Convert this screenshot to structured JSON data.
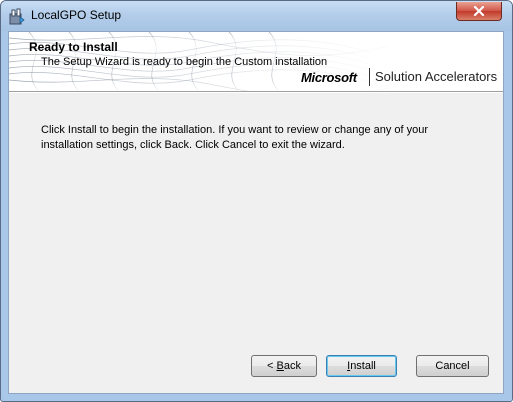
{
  "window": {
    "title": "LocalGPO Setup",
    "close_label": "Close"
  },
  "banner": {
    "title": "Ready to Install",
    "subtitle": "The Setup Wizard is ready to begin the Custom installation",
    "brand": "Microsoft",
    "product": "Solution Accelerators"
  },
  "body": {
    "message": "Click Install to begin the installation. If you want to review or change any of your installation settings, click Back. Click Cancel to exit the wizard."
  },
  "buttons": {
    "back_prefix": "< ",
    "back_mnemonic": "B",
    "back_rest": "ack",
    "install_mnemonic": "I",
    "install_rest": "nstall",
    "cancel": "Cancel"
  },
  "colors": {
    "titlebar": "#b3cdea",
    "close_button": "#c23a2a",
    "dialog_background": "#f0f0f0"
  }
}
